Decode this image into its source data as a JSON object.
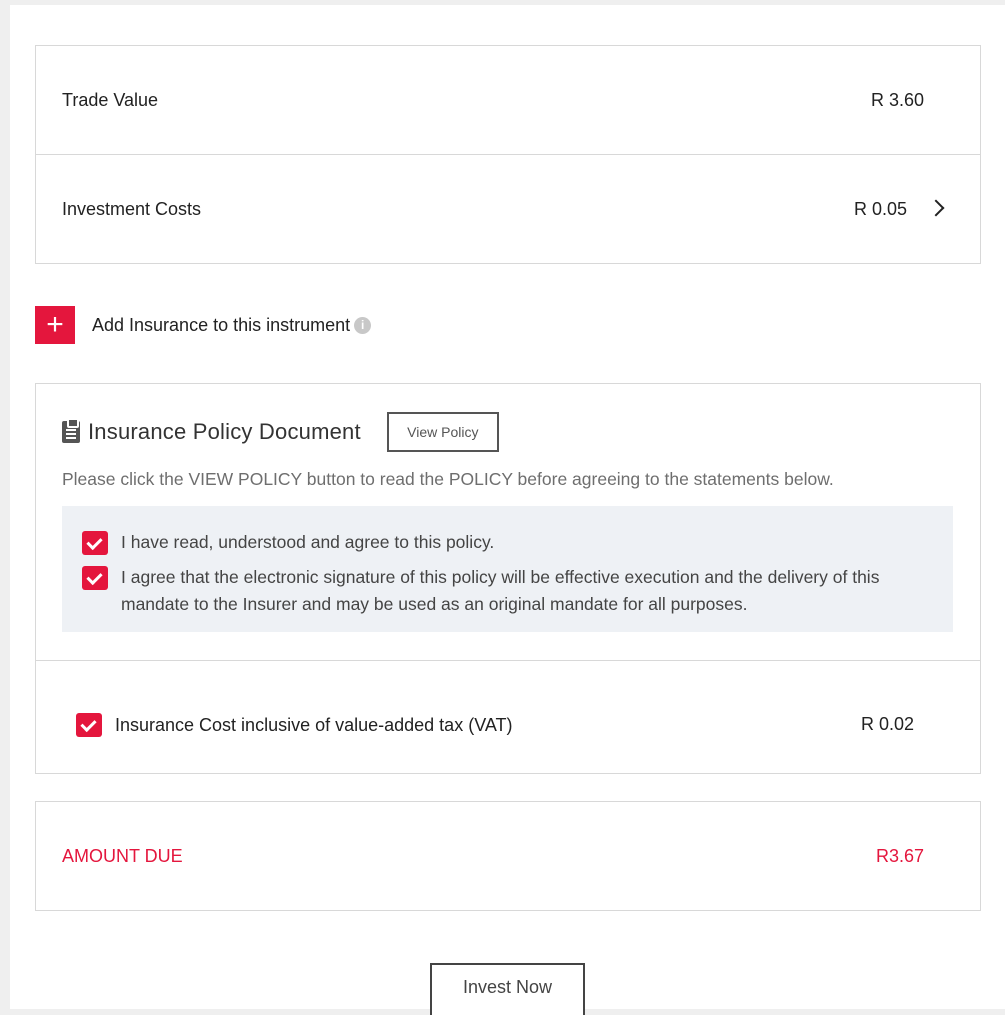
{
  "summary": {
    "trade_value_label": "Trade Value",
    "trade_value": "R 3.60",
    "investment_costs_label": "Investment Costs",
    "investment_costs": "R 0.05"
  },
  "insurance_toggle": {
    "plus_symbol": "+",
    "label": "Add Insurance to this instrument",
    "info_symbol": "i"
  },
  "policy": {
    "title": "Insurance Policy Document",
    "view_button_label": "View Policy",
    "note": "Please click the VIEW POLICY button to read the POLICY before agreeing to the statements below.",
    "agreements": [
      {
        "text": "I have read, understood and agree to this policy.",
        "checked": true
      },
      {
        "text": "I agree that the electronic signature of this policy will be effective execution and the delivery of this mandate to the Insurer and may be used as an original mandate for all purposes.",
        "checked": true
      }
    ],
    "cost_label": "Insurance Cost inclusive of value-added tax (VAT)",
    "cost_checked": true,
    "cost_value": "R 0.02"
  },
  "amount_due": {
    "label": "AMOUNT DUE",
    "value": "R3.67"
  },
  "invest_button_label": "Invest Now",
  "colors": {
    "accent": "#e4163d",
    "agree_box_bg": "#eef1f5",
    "border": "#d8d8d8",
    "page_bg": "#efefef"
  }
}
